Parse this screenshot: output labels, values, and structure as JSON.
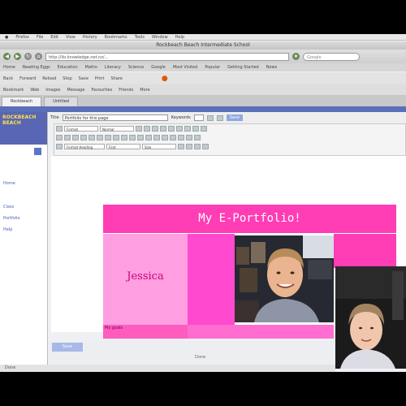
{
  "menubar": {
    "items": [
      "Firefox",
      "File",
      "Edit",
      "View",
      "History",
      "Bookmarks",
      "Tools",
      "Window",
      "Help"
    ]
  },
  "window": {
    "title": "Rockbeach Beach Intermediate School"
  },
  "urlbar": {
    "url": "http://ilo.knowledge.net.nz/...",
    "search_placeholder": "Google"
  },
  "bookmarks": {
    "items": [
      "Home",
      "Reading Eggs",
      "Education",
      "Maths",
      "Literacy",
      "Science",
      "Google",
      "Most Visited",
      "Popular",
      "Getting Started",
      "News"
    ]
  },
  "toolbar2": {
    "items": [
      "Back",
      "Forward",
      "Reload",
      "Stop",
      "Save",
      "Print",
      "Share"
    ]
  },
  "toolbar3": {
    "items": [
      "Bookmark",
      "Web",
      "Images",
      "Message",
      "Favourites",
      "Friends",
      "More"
    ]
  },
  "tabs": [
    {
      "label": "Rockbeach",
      "active": true
    },
    {
      "label": "Untitled",
      "active": false
    }
  ],
  "sidebar": {
    "header": "ROCKBEACH BEACH",
    "links": [
      "Home",
      "Class",
      "Portfolio",
      "Help"
    ]
  },
  "editor": {
    "title_label": "Title",
    "title_value": "Portfolio for this page",
    "keywords_label": "Keywords",
    "save_label": "Save"
  },
  "rte": {
    "row1_selects": [
      "Format",
      "Normal"
    ],
    "row3_selects": [
      "Format Heading",
      "Font",
      "Size"
    ]
  },
  "portfolio": {
    "title": "My E-Portfolio!",
    "name": "Jessica",
    "name_footer": "My goals"
  },
  "status": {
    "text": "Done",
    "small_save": "Save"
  },
  "colors": {
    "hot_pink": "#ff3db4",
    "light_pink": "#ff9ee0",
    "sidebar_blue": "#5866b4"
  }
}
